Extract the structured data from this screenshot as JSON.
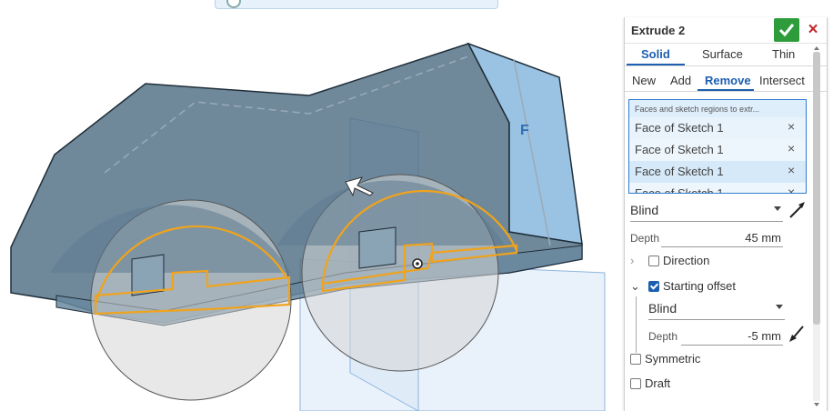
{
  "feature": {
    "title": "Extrude 2",
    "ok_icon": "checkmark-icon",
    "close_icon": "close-icon"
  },
  "type_tabs": [
    "Solid",
    "Surface",
    "Thin"
  ],
  "active_type_tab": "Solid",
  "operation_tabs": [
    "New",
    "Add",
    "Remove",
    "Intersect"
  ],
  "active_operation_tab": "Remove",
  "faces": {
    "title": "Faces and sketch regions to extr...",
    "items": [
      "Face of Sketch 1",
      "Face of Sketch 1",
      "Face of Sketch 1",
      "Face of Sketch 1"
    ],
    "remove_icon": "×"
  },
  "end_type": "Blind",
  "depth": {
    "label": "Depth",
    "value": "45 mm"
  },
  "direction": {
    "label": "Direction",
    "checked": false
  },
  "starting_offset": {
    "label": "Starting offset",
    "checked": true,
    "type": "Blind",
    "depth_label": "Depth",
    "depth_value": "-5 mm"
  },
  "symmetric": {
    "label": "Symmetric",
    "checked": false
  },
  "draft": {
    "label": "Draft",
    "checked": false
  },
  "colors": {
    "accent": "#1c5fb0",
    "ok": "#2e9c3a",
    "close": "#c02b2b",
    "sketch": "#f0a31c",
    "body": "#4f6f85",
    "selection": "#9ec9ec"
  }
}
